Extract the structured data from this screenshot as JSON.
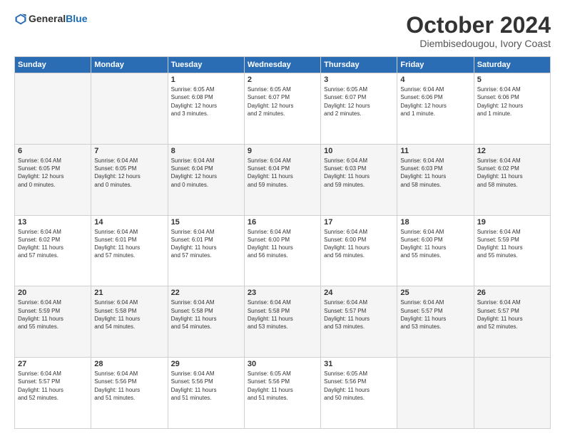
{
  "header": {
    "logo_general": "General",
    "logo_blue": "Blue",
    "month_title": "October 2024",
    "location": "Diembisedougou, Ivory Coast"
  },
  "weekdays": [
    "Sunday",
    "Monday",
    "Tuesday",
    "Wednesday",
    "Thursday",
    "Friday",
    "Saturday"
  ],
  "weeks": [
    [
      {
        "day": "",
        "info": ""
      },
      {
        "day": "",
        "info": ""
      },
      {
        "day": "1",
        "info": "Sunrise: 6:05 AM\nSunset: 6:08 PM\nDaylight: 12 hours\nand 3 minutes."
      },
      {
        "day": "2",
        "info": "Sunrise: 6:05 AM\nSunset: 6:07 PM\nDaylight: 12 hours\nand 2 minutes."
      },
      {
        "day": "3",
        "info": "Sunrise: 6:05 AM\nSunset: 6:07 PM\nDaylight: 12 hours\nand 2 minutes."
      },
      {
        "day": "4",
        "info": "Sunrise: 6:04 AM\nSunset: 6:06 PM\nDaylight: 12 hours\nand 1 minute."
      },
      {
        "day": "5",
        "info": "Sunrise: 6:04 AM\nSunset: 6:06 PM\nDaylight: 12 hours\nand 1 minute."
      }
    ],
    [
      {
        "day": "6",
        "info": "Sunrise: 6:04 AM\nSunset: 6:05 PM\nDaylight: 12 hours\nand 0 minutes."
      },
      {
        "day": "7",
        "info": "Sunrise: 6:04 AM\nSunset: 6:05 PM\nDaylight: 12 hours\nand 0 minutes."
      },
      {
        "day": "8",
        "info": "Sunrise: 6:04 AM\nSunset: 6:04 PM\nDaylight: 12 hours\nand 0 minutes."
      },
      {
        "day": "9",
        "info": "Sunrise: 6:04 AM\nSunset: 6:04 PM\nDaylight: 11 hours\nand 59 minutes."
      },
      {
        "day": "10",
        "info": "Sunrise: 6:04 AM\nSunset: 6:03 PM\nDaylight: 11 hours\nand 59 minutes."
      },
      {
        "day": "11",
        "info": "Sunrise: 6:04 AM\nSunset: 6:03 PM\nDaylight: 11 hours\nand 58 minutes."
      },
      {
        "day": "12",
        "info": "Sunrise: 6:04 AM\nSunset: 6:02 PM\nDaylight: 11 hours\nand 58 minutes."
      }
    ],
    [
      {
        "day": "13",
        "info": "Sunrise: 6:04 AM\nSunset: 6:02 PM\nDaylight: 11 hours\nand 57 minutes."
      },
      {
        "day": "14",
        "info": "Sunrise: 6:04 AM\nSunset: 6:01 PM\nDaylight: 11 hours\nand 57 minutes."
      },
      {
        "day": "15",
        "info": "Sunrise: 6:04 AM\nSunset: 6:01 PM\nDaylight: 11 hours\nand 57 minutes."
      },
      {
        "day": "16",
        "info": "Sunrise: 6:04 AM\nSunset: 6:00 PM\nDaylight: 11 hours\nand 56 minutes."
      },
      {
        "day": "17",
        "info": "Sunrise: 6:04 AM\nSunset: 6:00 PM\nDaylight: 11 hours\nand 56 minutes."
      },
      {
        "day": "18",
        "info": "Sunrise: 6:04 AM\nSunset: 6:00 PM\nDaylight: 11 hours\nand 55 minutes."
      },
      {
        "day": "19",
        "info": "Sunrise: 6:04 AM\nSunset: 5:59 PM\nDaylight: 11 hours\nand 55 minutes."
      }
    ],
    [
      {
        "day": "20",
        "info": "Sunrise: 6:04 AM\nSunset: 5:59 PM\nDaylight: 11 hours\nand 55 minutes."
      },
      {
        "day": "21",
        "info": "Sunrise: 6:04 AM\nSunset: 5:58 PM\nDaylight: 11 hours\nand 54 minutes."
      },
      {
        "day": "22",
        "info": "Sunrise: 6:04 AM\nSunset: 5:58 PM\nDaylight: 11 hours\nand 54 minutes."
      },
      {
        "day": "23",
        "info": "Sunrise: 6:04 AM\nSunset: 5:58 PM\nDaylight: 11 hours\nand 53 minutes."
      },
      {
        "day": "24",
        "info": "Sunrise: 6:04 AM\nSunset: 5:57 PM\nDaylight: 11 hours\nand 53 minutes."
      },
      {
        "day": "25",
        "info": "Sunrise: 6:04 AM\nSunset: 5:57 PM\nDaylight: 11 hours\nand 53 minutes."
      },
      {
        "day": "26",
        "info": "Sunrise: 6:04 AM\nSunset: 5:57 PM\nDaylight: 11 hours\nand 52 minutes."
      }
    ],
    [
      {
        "day": "27",
        "info": "Sunrise: 6:04 AM\nSunset: 5:57 PM\nDaylight: 11 hours\nand 52 minutes."
      },
      {
        "day": "28",
        "info": "Sunrise: 6:04 AM\nSunset: 5:56 PM\nDaylight: 11 hours\nand 51 minutes."
      },
      {
        "day": "29",
        "info": "Sunrise: 6:04 AM\nSunset: 5:56 PM\nDaylight: 11 hours\nand 51 minutes."
      },
      {
        "day": "30",
        "info": "Sunrise: 6:05 AM\nSunset: 5:56 PM\nDaylight: 11 hours\nand 51 minutes."
      },
      {
        "day": "31",
        "info": "Sunrise: 6:05 AM\nSunset: 5:56 PM\nDaylight: 11 hours\nand 50 minutes."
      },
      {
        "day": "",
        "info": ""
      },
      {
        "day": "",
        "info": ""
      }
    ]
  ]
}
